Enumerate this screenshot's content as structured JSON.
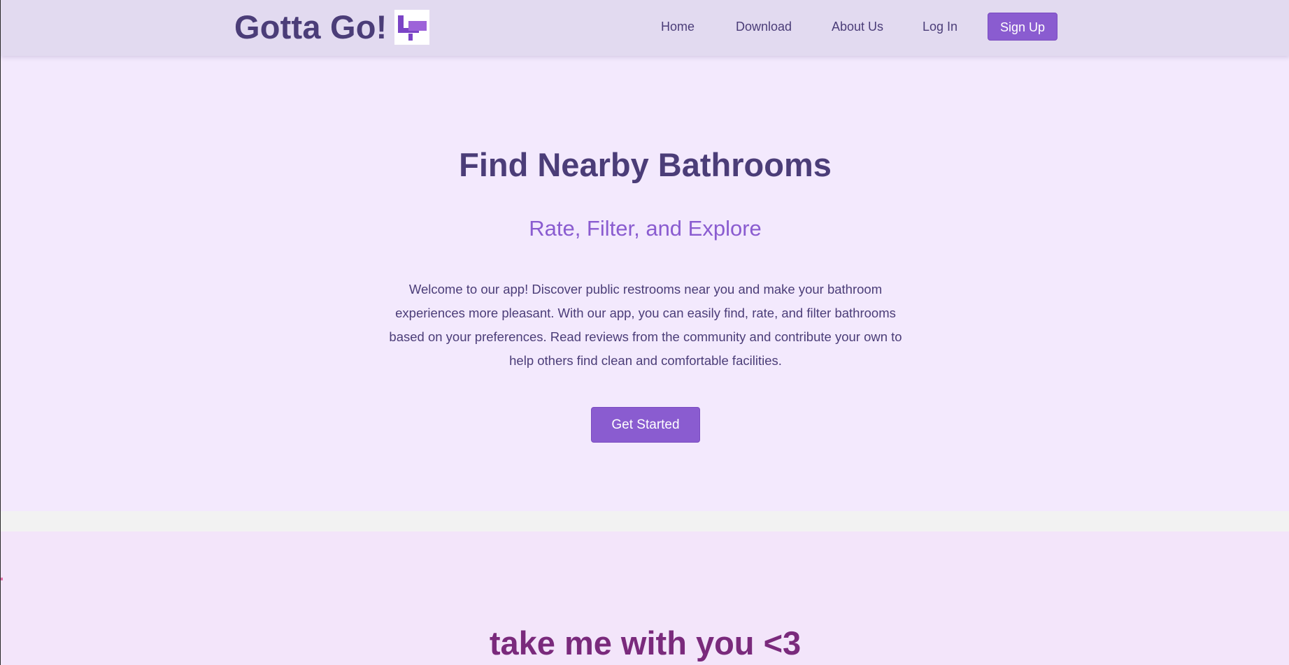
{
  "header": {
    "brand_title": "Gotta Go!",
    "logo_text": "Gotta Go!",
    "nav": {
      "home": "Home",
      "download": "Download",
      "about": "About Us",
      "login": "Log In",
      "signup": "Sign Up"
    }
  },
  "hero": {
    "title": "Find Nearby Bathrooms",
    "subtitle": "Rate, Filter, and Explore",
    "description": "Welcome to our app! Discover public restrooms near you and make your bathroom experiences more pleasant. With our app, you can easily find, rate, and filter bathrooms based on your preferences. Read reviews from the community and contribute your own to help others find clean and comfortable facilities.",
    "cta_label": "Get Started"
  },
  "section2": {
    "title": "take me with you <3"
  },
  "colors": {
    "header_bg": "#e2daf0",
    "hero_bg": "#f3e9fd",
    "accent": "#8a5cd0",
    "primary_text": "#4b3d78",
    "section2_title": "#7a2a7c"
  }
}
